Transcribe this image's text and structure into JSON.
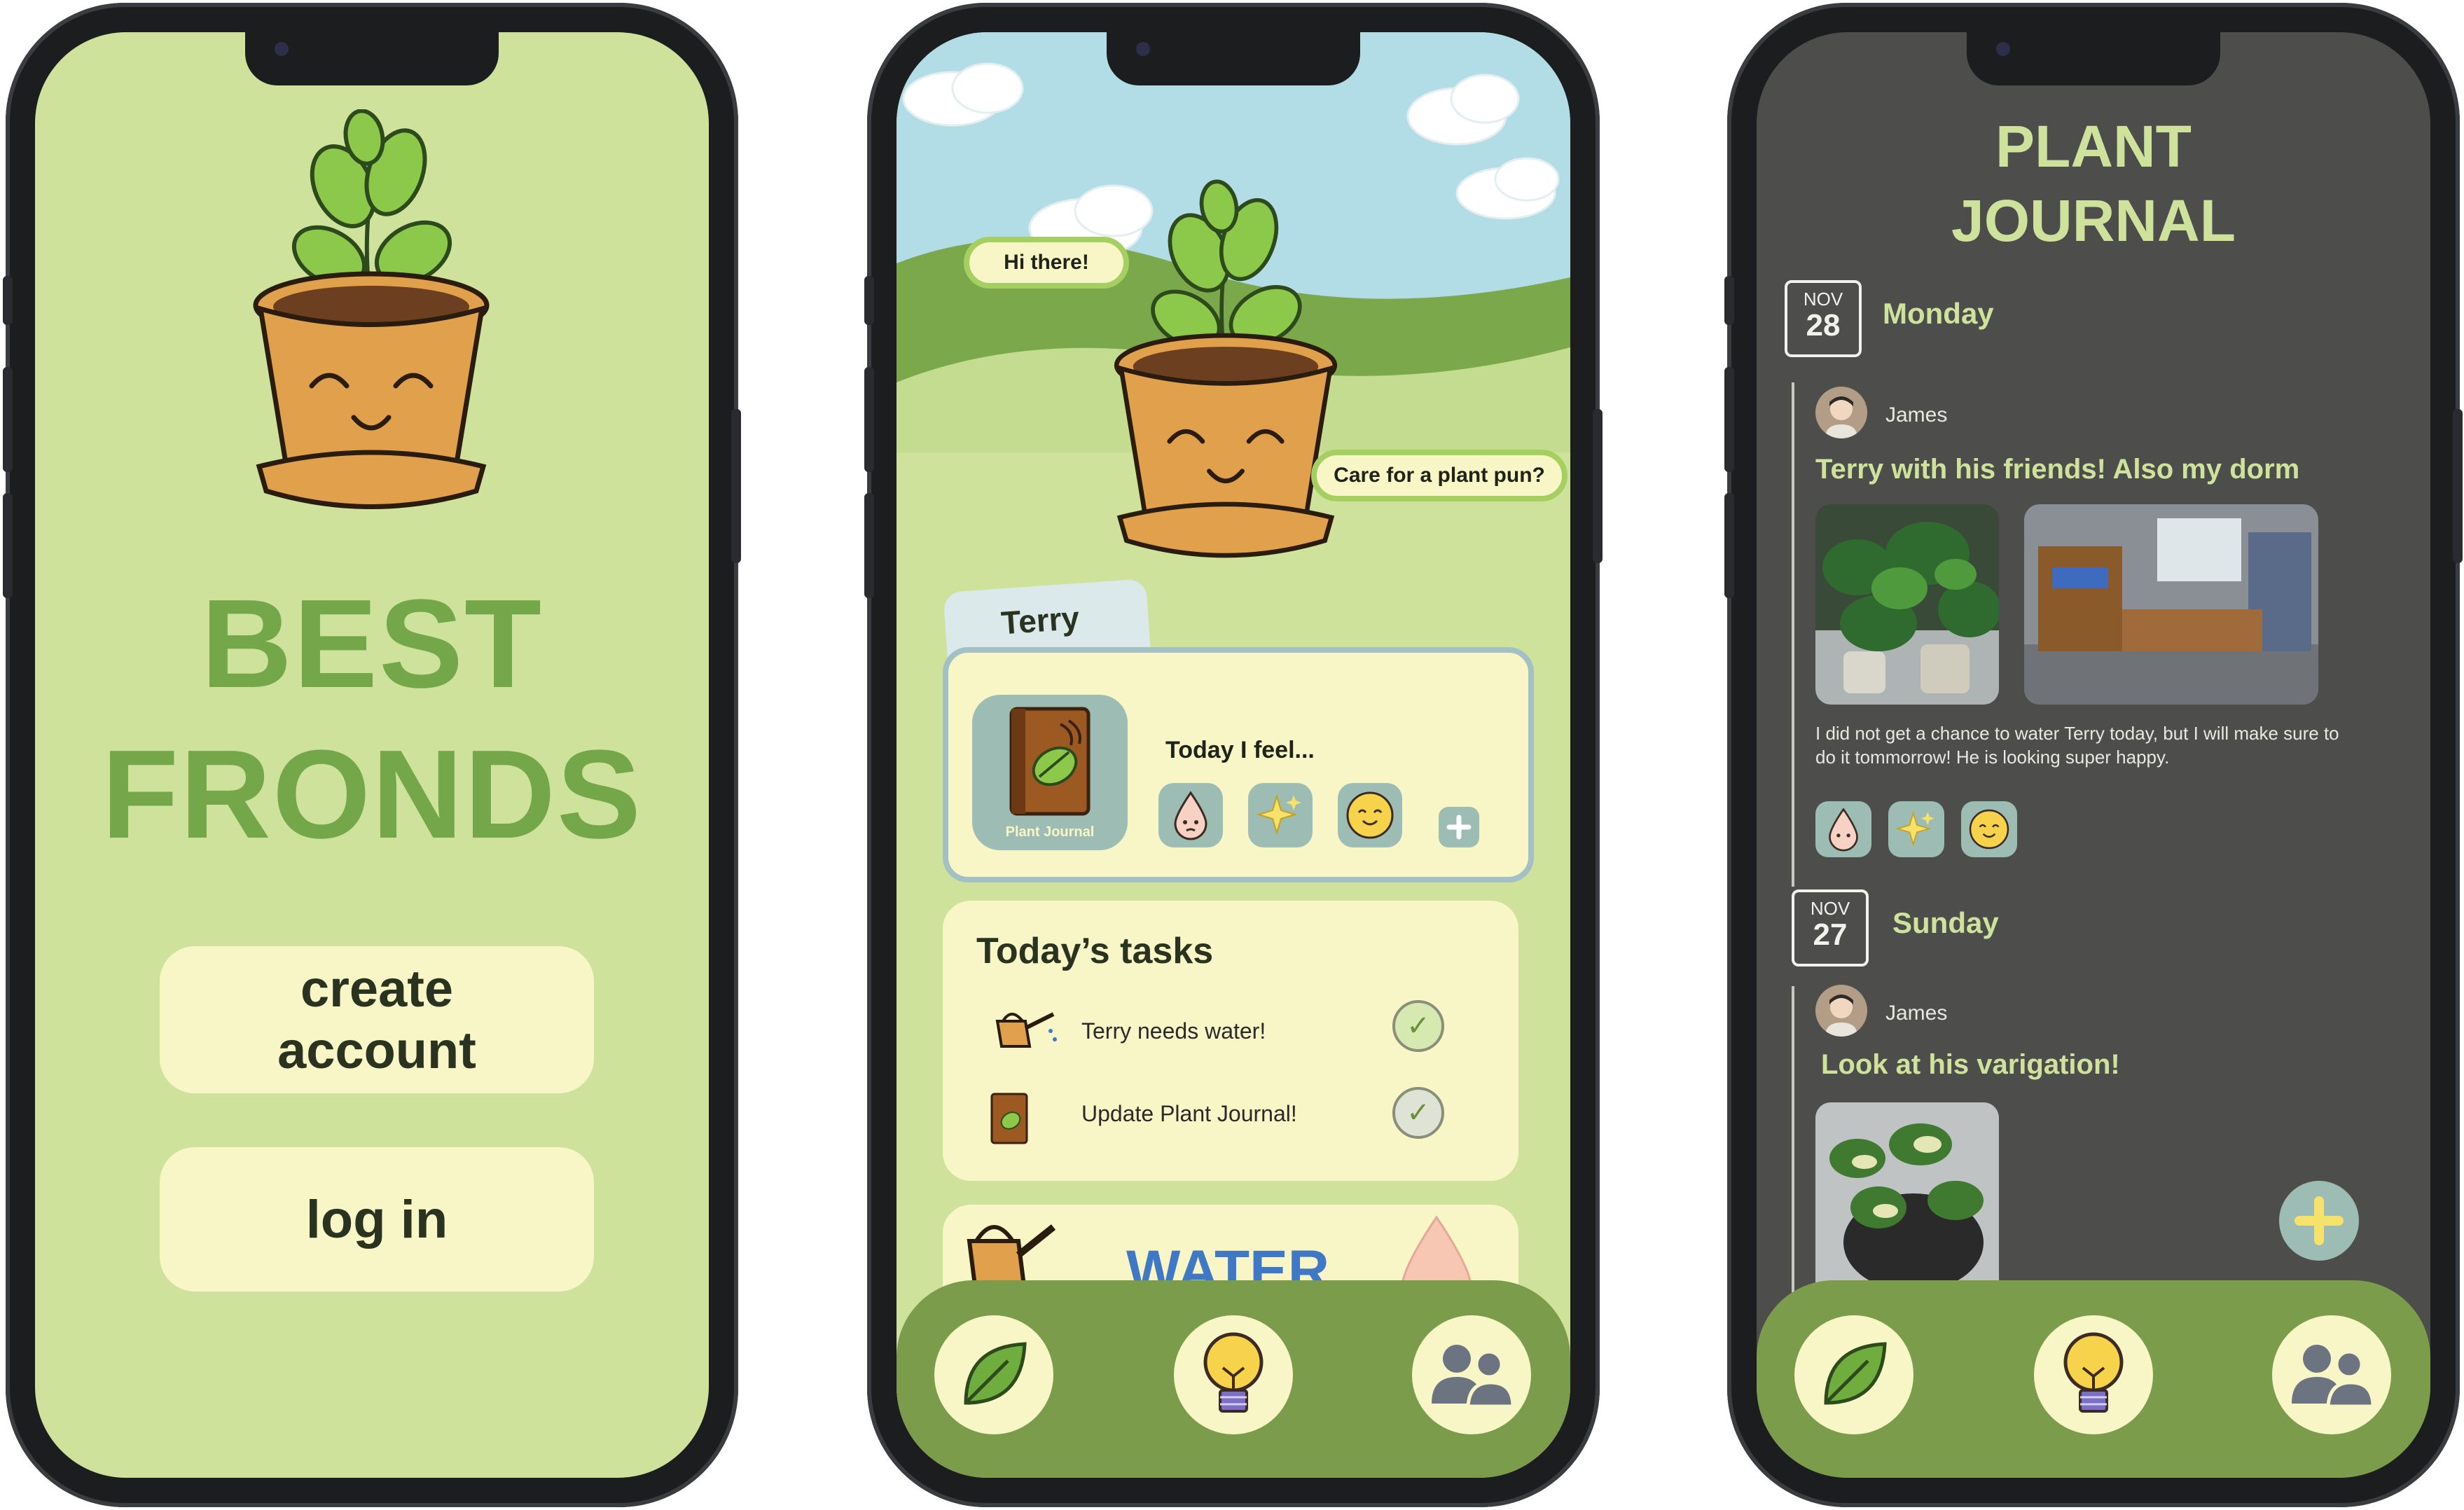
{
  "screen1": {
    "brand_line1": "BEST",
    "brand_line2": "FRONDS",
    "create_account_line1": "create",
    "create_account_line2": "account",
    "login_label": "log in"
  },
  "screen2": {
    "bubble_greeting": "Hi there!",
    "bubble_pun": "Care for a plant pun?",
    "plant_name_tab": "Terry",
    "journal_tile_label": "Plant Journal",
    "feel_label": "Today I feel...",
    "tasks_title": "Today’s tasks",
    "tasks": [
      {
        "label": "Terry needs water!"
      },
      {
        "label": "Update Plant Journal!"
      }
    ],
    "water_label": "WATER",
    "nav": [
      "leaf-icon",
      "lightbulb-icon",
      "friends-icon"
    ]
  },
  "screen3": {
    "title_line1": "PLANT",
    "title_line2": "JOURNAL",
    "entries": [
      {
        "month": "NOV",
        "day": "28",
        "weekday": "Monday",
        "user": "James",
        "title": "Terry with his friends! Also my dorm",
        "text": "I did not get a chance to water Terry today, but I will make sure to do it tommorrow! He is looking super happy."
      },
      {
        "month": "NOV",
        "day": "27",
        "weekday": "Sunday",
        "user": "James",
        "title": "Look at his varigation!"
      }
    ]
  },
  "colors": {
    "light_green": "#cfe29c",
    "brand_green": "#74a64a",
    "cream": "#f8f5c6",
    "nav_green": "#7b9c4a",
    "journal_dark": "#4d4e4b",
    "pot_orange": "#e0a04c",
    "water_blue": "#3f78c4"
  }
}
